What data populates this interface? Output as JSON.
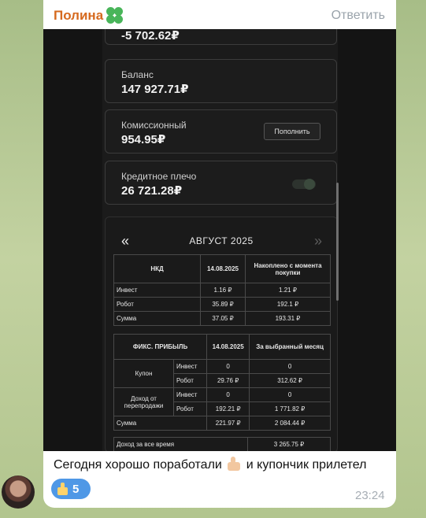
{
  "message": {
    "sender": "Полина",
    "reply_label": "Ответить",
    "caption": "Сегодня хорошо поработали",
    "caption_tail": "и купончик прилетел",
    "reaction_count": "5",
    "time": "23:24",
    "icons": [
      "clover-emoji-icon",
      "thumbs-up-emoji-icon",
      "reaction-thumbs-up-icon",
      "user-avatar"
    ]
  },
  "screenshot": {
    "cards": {
      "top_value": "-5 702.62₽",
      "balance_label": "Баланс",
      "balance_value": "147 927.71₽",
      "commission_label": "Комиссионный",
      "commission_value": "954.95₽",
      "topup_label": "Пополнить",
      "leverage_label": "Кредитное плечо",
      "leverage_value": "26 721.28₽"
    },
    "report": {
      "prev_icon": "«",
      "next_icon": "»",
      "month": "АВГУСТ 2025",
      "nkd": {
        "h1": "НКД",
        "h2": "14.08.2025",
        "h3": "Накоплено с момента покупки",
        "rows": [
          {
            "name": "Инвест",
            "a": "1.16 ₽",
            "b": "1.21 ₽"
          },
          {
            "name": "Робот",
            "a": "35.89 ₽",
            "b": "192.1 ₽"
          },
          {
            "name": "Сумма",
            "a": "37.05 ₽",
            "b": "193.31 ₽"
          }
        ]
      },
      "fix": {
        "h1": "ФИКС. ПРИБЫЛЬ",
        "h2": "14.08.2025",
        "h3": "За выбранный месяц",
        "coupon": "Купон",
        "resale": "Доход от перепродажи",
        "invest": "Инвест",
        "robot": "Робот",
        "c_inv_a": "0",
        "c_inv_b": "0",
        "c_rob_a": "29.76 ₽",
        "c_rob_b": "312.62 ₽",
        "r_inv_a": "0",
        "r_inv_b": "0",
        "r_rob_a": "192.21 ₽",
        "r_rob_b": "1 771.82 ₽",
        "sum": "Сумма",
        "sum_a": "221.97 ₽",
        "sum_b": "2 084.44 ₽"
      },
      "alltime_label": "Доход за все время",
      "alltime_value": "3 265.75 ₽"
    }
  }
}
